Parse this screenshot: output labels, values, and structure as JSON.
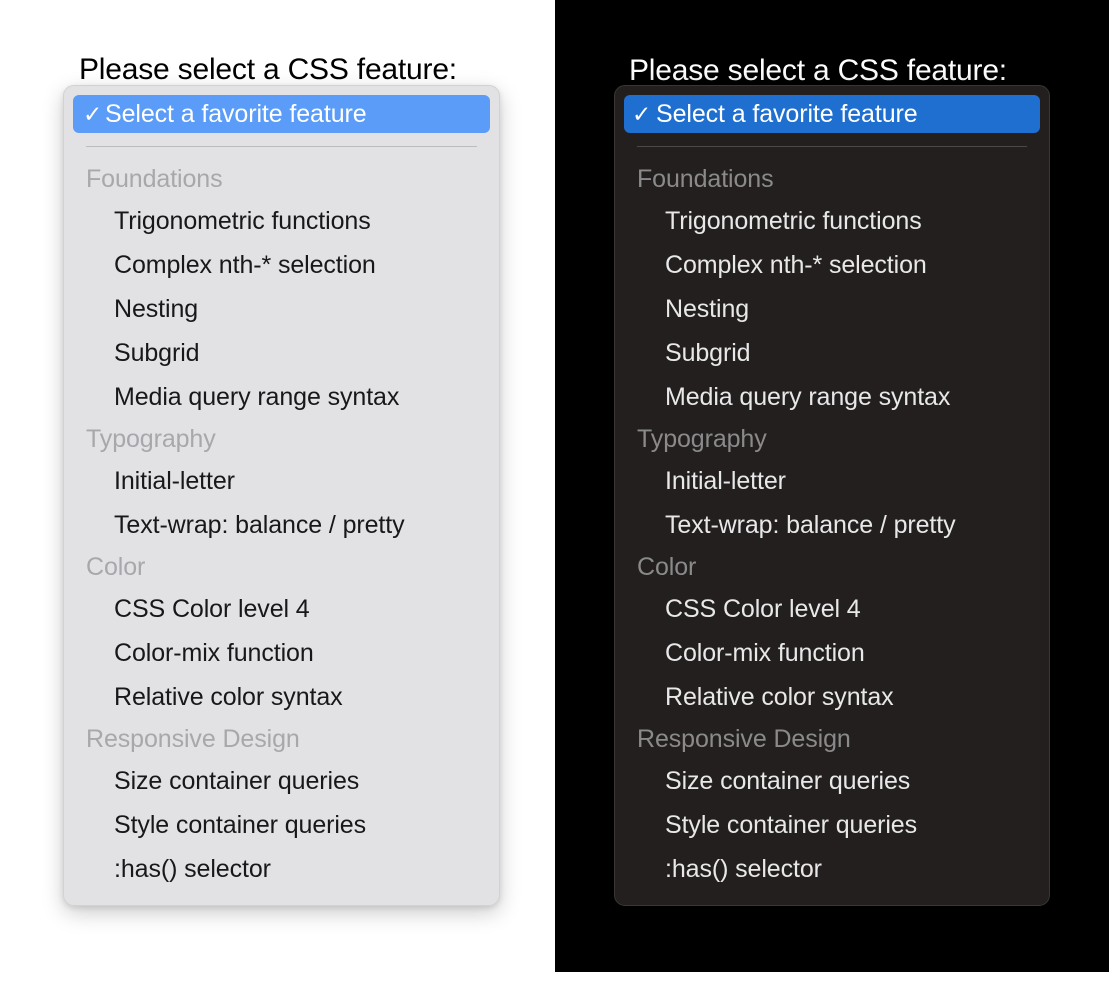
{
  "panes": [
    {
      "theme": "light",
      "title": "Please select a CSS feature:",
      "selected_option": "Select a favorite feature",
      "check_glyph": "✓",
      "colors": {
        "page_background": "#ffffff",
        "panel_background": "#e2e2e4",
        "highlight": "#5a9cf8",
        "item_text": "#18181a",
        "group_text": "#a8a8ac",
        "separator": "#bcbcbe",
        "title_text": "#000000"
      },
      "groups": [
        {
          "label": "Foundations",
          "options": [
            "Trigonometric functions",
            "Complex nth-* selection",
            "Nesting",
            "Subgrid",
            "Media query range syntax"
          ]
        },
        {
          "label": "Typography",
          "options": [
            "Initial-letter",
            "Text-wrap: balance / pretty"
          ]
        },
        {
          "label": "Color",
          "options": [
            "CSS Color level 4",
            "Color-mix function",
            "Relative color syntax"
          ]
        },
        {
          "label": "Responsive Design",
          "options": [
            "Size container queries",
            "Style container queries",
            ":has() selector"
          ]
        }
      ]
    },
    {
      "theme": "dark",
      "title": "Please select a CSS feature:",
      "selected_option": "Select a favorite feature",
      "check_glyph": "✓",
      "colors": {
        "page_background": "#000000",
        "panel_background": "#231f1f",
        "highlight": "#1f6fd0",
        "item_text": "#e8e8e8",
        "group_text": "#8a8a8a",
        "separator": "#4d4949",
        "title_text": "#ffffff"
      },
      "groups": [
        {
          "label": "Foundations",
          "options": [
            "Trigonometric functions",
            "Complex nth-* selection",
            "Nesting",
            "Subgrid",
            "Media query range syntax"
          ]
        },
        {
          "label": "Typography",
          "options": [
            "Initial-letter",
            "Text-wrap: balance / pretty"
          ]
        },
        {
          "label": "Color",
          "options": [
            "CSS Color level 4",
            "Color-mix function",
            "Relative color syntax"
          ]
        },
        {
          "label": "Responsive Design",
          "options": [
            "Size container queries",
            "Style container queries",
            ":has() selector"
          ]
        }
      ]
    }
  ]
}
